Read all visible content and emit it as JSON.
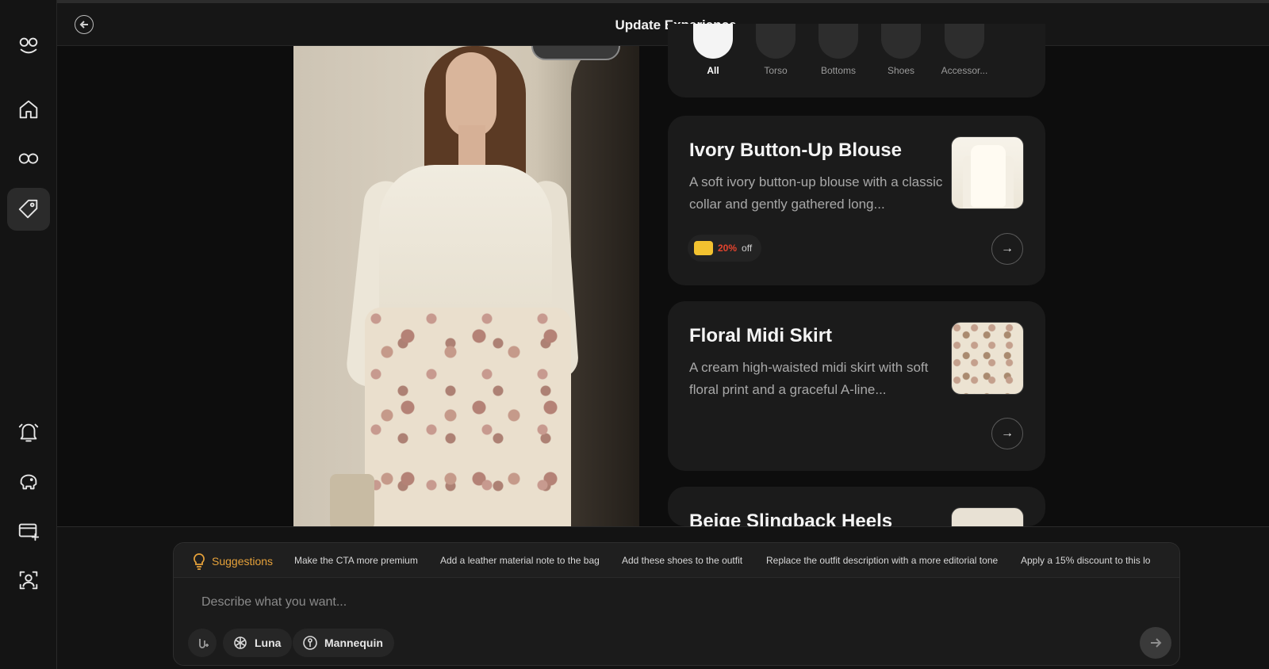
{
  "header": {
    "title": "Update Experience"
  },
  "sidebar": {
    "items": [
      {
        "name": "logo",
        "icon": "brand-logo-icon"
      },
      {
        "name": "home",
        "icon": "home-icon"
      },
      {
        "name": "experiences",
        "icon": "brand-mark-icon"
      },
      {
        "name": "products",
        "icon": "tag-icon",
        "active": true
      },
      {
        "name": "notifications",
        "icon": "bell-icon"
      },
      {
        "name": "savings",
        "icon": "piggy-bank-icon"
      },
      {
        "name": "billing",
        "icon": "credit-card-add-icon"
      },
      {
        "name": "profile",
        "icon": "user-scan-icon"
      }
    ]
  },
  "categories": [
    {
      "label": "All",
      "active": true
    },
    {
      "label": "Torso"
    },
    {
      "label": "Bottoms"
    },
    {
      "label": "Shoes"
    },
    {
      "label": "Accessor..."
    }
  ],
  "products": [
    {
      "title": "Ivory Button-Up Blouse",
      "description": "A soft ivory button-up blouse with a classic collar and gently gathered long...",
      "discount": {
        "percent": "20%",
        "suffix": "off"
      }
    },
    {
      "title": "Floral Midi Skirt",
      "description": "A cream high-waisted midi skirt with soft floral print and a graceful A-line..."
    },
    {
      "title": "Beige Slingback Heels",
      "description": ""
    }
  ],
  "suggestions": {
    "label": "Suggestions",
    "chips": [
      "Make the CTA more premium",
      "Add a leather material note to the bag",
      "Add these shoes to the outfit",
      "Replace the outfit description with a more editorial tone",
      "Apply a 15% discount to this lo"
    ]
  },
  "prompt": {
    "placeholder": "Describe what you want...",
    "model_label": "Luna",
    "mode_label": "Mannequin"
  },
  "colors": {
    "accent": "#e5a13a",
    "discount": "#e5442e",
    "background": "#0d0d0d"
  }
}
